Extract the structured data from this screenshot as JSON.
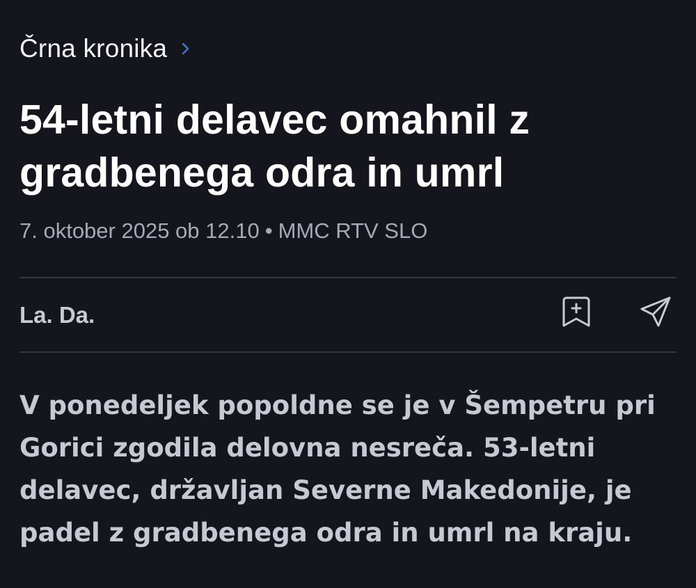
{
  "breadcrumb": {
    "label": "Črna kronika",
    "chevron_icon": "chevron-right-icon"
  },
  "article": {
    "headline": "54-letni delavec omahnil z gradbenega odra in umrl",
    "date": "7. oktober 2025 ob 12.10",
    "separator": "•",
    "source": "MMC RTV SLO",
    "author": "La. Da.",
    "lead": "V ponedeljek popoldne se je v Šempetru pri Gorici zgodila delovna nesreča. 53-letni delavec, državljan Severne Makedonije, je padel z gradbenega odra in umrl na kraju."
  },
  "actions": {
    "bookmark_icon": "bookmark-add-icon",
    "share_icon": "share-send-icon"
  },
  "colors": {
    "background": "#15161d",
    "accent": "#4a78c9",
    "text_primary": "#ffffff",
    "text_secondary": "#a7aab5",
    "divider": "#34363f"
  }
}
